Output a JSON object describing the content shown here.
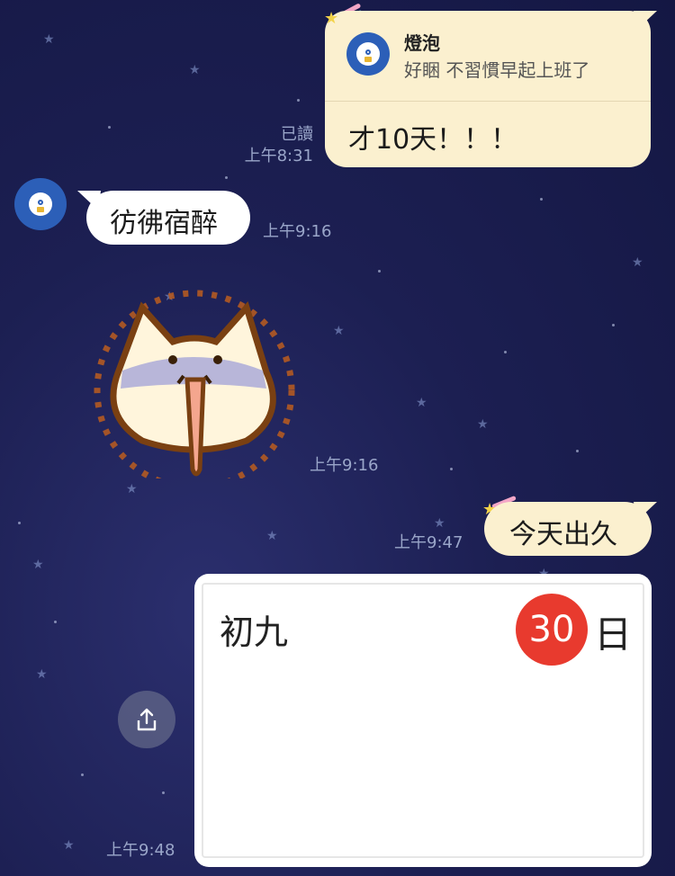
{
  "chat": {
    "reply_card": {
      "quoted_sender": "燈泡",
      "quoted_text": "好睏 不習慣早起上班了",
      "message": "才10天！！！",
      "read_status": "已讀",
      "time": "上午8:31"
    },
    "msg_fangfu": {
      "text": "彷彿宿醉",
      "time": "上午9:16"
    },
    "sticker": {
      "time": "上午9:16",
      "name": "cat-sticker"
    },
    "msg_jintian": {
      "text": "今天出久",
      "time": "上午9:47"
    },
    "calendar_image": {
      "lunar_day": "初九",
      "day_number": "30",
      "day_unit": "日",
      "time": "上午9:48"
    }
  },
  "colors": {
    "my_bubble": "#fbf0cf",
    "their_bubble": "#ffffff",
    "avatar": "#2c5fb8",
    "day_badge": "#e83a2e"
  },
  "icons": {
    "avatar": "lightbulb-avatar-icon",
    "share": "share-icon"
  }
}
